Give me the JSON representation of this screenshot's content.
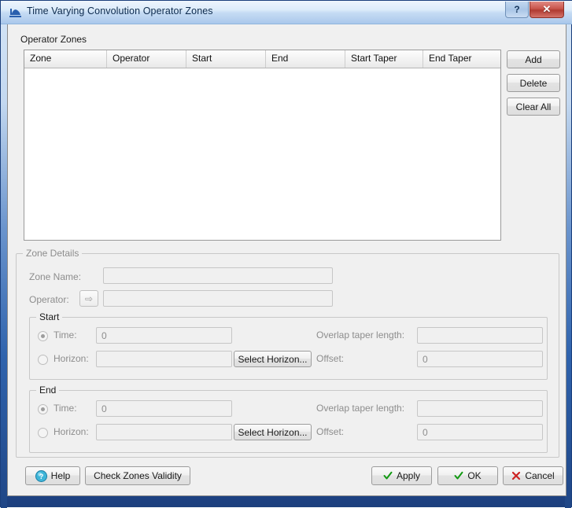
{
  "window": {
    "title": "Time Varying Convolution Operator Zones",
    "icon": "app-icon",
    "help_button": "?",
    "close_button": "✕"
  },
  "operator_zones": {
    "group_title": "Operator Zones",
    "columns": [
      {
        "label": "Zone",
        "width": 105
      },
      {
        "label": "Operator",
        "width": 101
      },
      {
        "label": "Start",
        "width": 101
      },
      {
        "label": "End",
        "width": 101
      },
      {
        "label": "Start Taper",
        "width": 99
      },
      {
        "label": "End Taper",
        "width": 98
      }
    ],
    "rows": [],
    "buttons": [
      {
        "label": "Add",
        "name": "add-button"
      },
      {
        "label": "Delete",
        "name": "delete-button"
      },
      {
        "label": "Clear All",
        "name": "clear-all-button"
      }
    ]
  },
  "zone_details": {
    "group_title": "Zone Details",
    "zone_name_label": "Zone Name:",
    "zone_name_value": "",
    "operator_label": "Operator:",
    "operator_value": "",
    "operator_browse_icon": "⇨",
    "start": {
      "group_title": "Start",
      "time_label": "Time:",
      "time_value": "0",
      "time_selected": true,
      "horizon_label": "Horizon:",
      "horizon_value": "",
      "horizon_selected": false,
      "select_horizon_label": "Select Horizon...",
      "overlap_taper_label": "Overlap taper length:",
      "overlap_taper_value": "",
      "offset_label": "Offset:",
      "offset_value": "0"
    },
    "end": {
      "group_title": "End",
      "time_label": "Time:",
      "time_value": "0",
      "time_selected": true,
      "horizon_label": "Horizon:",
      "horizon_value": "",
      "horizon_selected": false,
      "select_horizon_label": "Select Horizon...",
      "overlap_taper_label": "Overlap taper length:",
      "overlap_taper_value": "",
      "offset_label": "Offset:",
      "offset_value": "0"
    }
  },
  "footer": {
    "help_label": "Help",
    "check_validity_label": "Check Zones Validity",
    "apply_label": "Apply",
    "ok_label": "OK",
    "cancel_label": "Cancel"
  },
  "colors": {
    "title_bar_blue": "#c6dcf4",
    "frame_blue": "#2f63ad",
    "close_red": "#c9564c",
    "help_cyan": "#3fb5d8",
    "check_green": "#119911",
    "cancel_red": "#cc2222",
    "client_bg": "#f0f0f0",
    "table_bg": "#ffffff",
    "disabled_text": "#8d8d8d"
  }
}
